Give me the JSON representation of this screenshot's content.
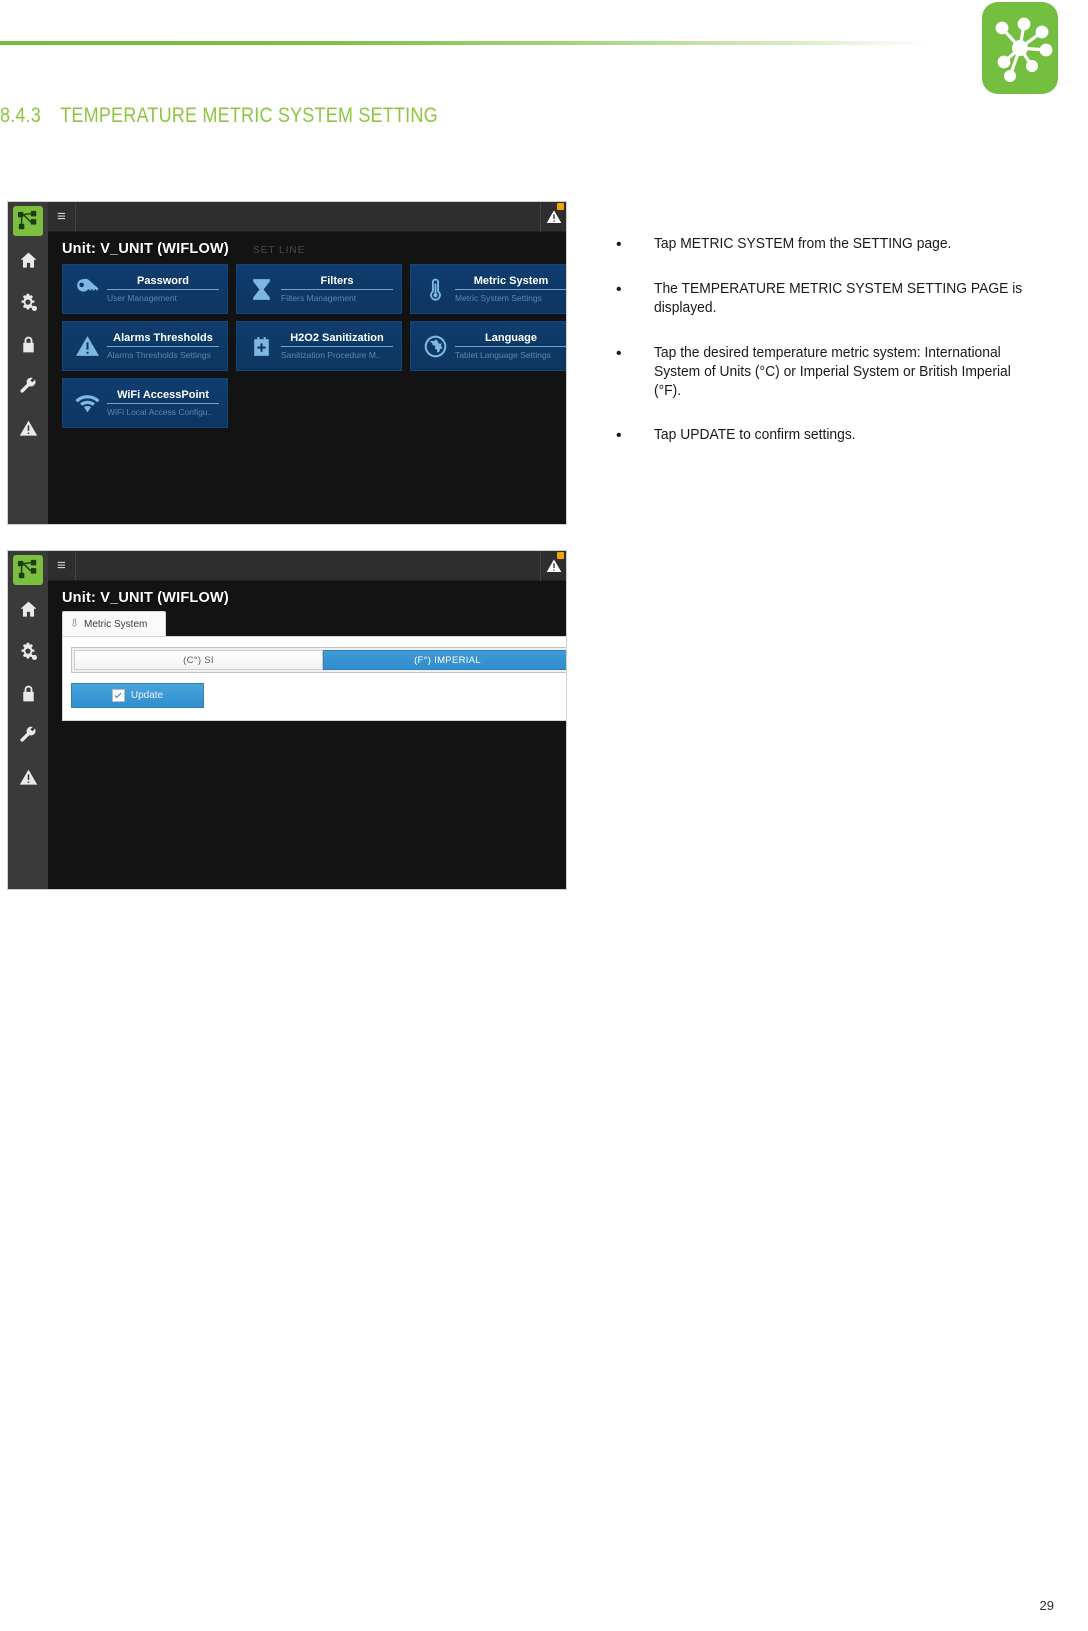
{
  "document": {
    "section_number": "8.4.3",
    "section_title": "TEMPERATURE METRIC SYSTEM SETTING",
    "page_number": "29",
    "accent_color": "#8cc63f",
    "brand_logo_color": "#74bf3f"
  },
  "instructions": [
    {
      "text": "Tap METRIC SYSTEM from the SETTING page."
    },
    {
      "text": "The TEMPERATURE METRIC SYSTEM SETTING PAGE is displayed."
    },
    {
      "text": "Tap the desired temperature metric system: International System of Units (°C) or Imperial System or British Imperial (°F)."
    },
    {
      "text": "Tap UPDATE to confirm settings."
    }
  ],
  "screenshot_setting_page": {
    "topbar": {
      "menu_label": "≡",
      "alarm_icon": "warning-triangle-icon"
    },
    "unit_title": "Unit: V_UNIT (WIFLOW)",
    "unit_subtitle": "SET LINE",
    "rail_items": [
      {
        "name": "app-logo",
        "icon": "network-nodes-icon"
      },
      {
        "name": "home",
        "icon": "home-icon"
      },
      {
        "name": "settings",
        "icon": "gears-icon"
      },
      {
        "name": "lock",
        "icon": "lock-icon"
      },
      {
        "name": "service",
        "icon": "wrench-icon"
      },
      {
        "name": "alarms",
        "icon": "warning-triangle-icon"
      }
    ],
    "tiles": [
      {
        "title": "Password",
        "subtitle": "User Management",
        "icon": "key-icon"
      },
      {
        "title": "Filters",
        "subtitle": "Filters Management",
        "icon": "hourglass-icon"
      },
      {
        "title": "Metric System",
        "subtitle": "Metric System Settings",
        "icon": "thermometer-icon"
      },
      {
        "title": "Alarms Thresholds",
        "subtitle": "Alarms Thresholds Settings",
        "icon": "warning-triangle-icon"
      },
      {
        "title": "H2O2 Sanitization",
        "subtitle": "Sanitization Procedure M..",
        "icon": "medical-kit-icon"
      },
      {
        "title": "Language",
        "subtitle": "Tablet Language Settings",
        "icon": "globe-icon"
      },
      {
        "title": "WiFi AccessPoint",
        "subtitle": "WiFi Local Access Configu..",
        "icon": "wifi-icon"
      }
    ]
  },
  "screenshot_metric_page": {
    "topbar": {
      "menu_label": "≡",
      "alarm_icon": "warning-triangle-icon"
    },
    "unit_title": "Unit: V_UNIT (WIFLOW)",
    "tab_label": "Metric System",
    "tab_icon": "thermometer-icon",
    "options": [
      {
        "label": "(C°) SI",
        "selected": false
      },
      {
        "label": "(F°) IMPERIAL",
        "selected": true
      }
    ],
    "update_button_label": "Update",
    "selected_color": "#2f8ecd"
  }
}
